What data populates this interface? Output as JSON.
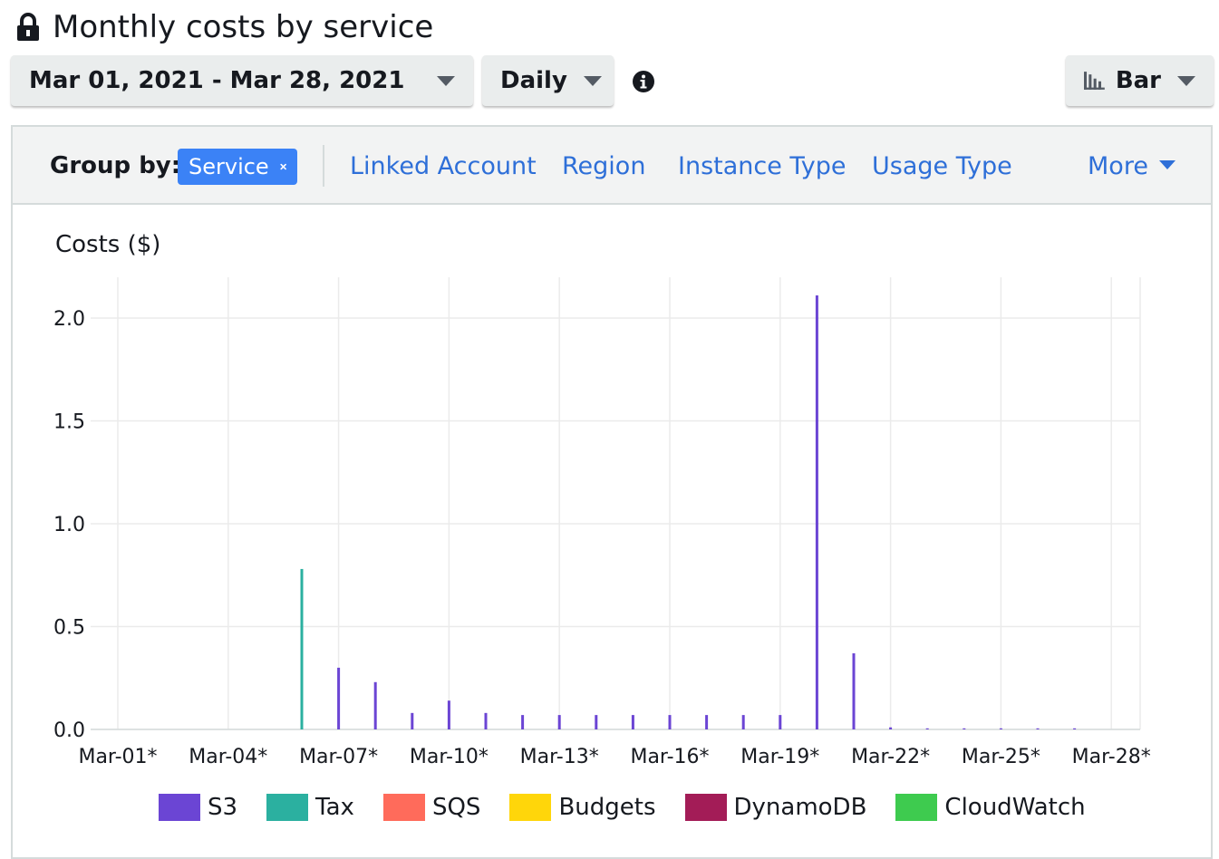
{
  "header": {
    "title": "Monthly costs by service"
  },
  "controls": {
    "date_range": "Mar 01, 2021 - Mar 28, 2021",
    "granularity": "Daily",
    "chart_type": "Bar"
  },
  "group_by": {
    "label": "Group by:",
    "active_chip": "Service",
    "options": [
      "Linked Account",
      "Region",
      "Instance Type",
      "Usage Type"
    ],
    "more": "More"
  },
  "chart_data": {
    "type": "bar",
    "ylabel": "Costs ($)",
    "ylim": [
      0,
      2.2
    ],
    "yticks": [
      "0.0",
      "0.5",
      "1.0",
      "1.5",
      "2.0"
    ],
    "xtick_labels": [
      "Mar-01*",
      "Mar-04*",
      "Mar-07*",
      "Mar-10*",
      "Mar-13*",
      "Mar-16*",
      "Mar-19*",
      "Mar-22*",
      "Mar-25*",
      "Mar-28*"
    ],
    "categories": [
      "Mar-01",
      "Mar-02",
      "Mar-03",
      "Mar-04",
      "Mar-05",
      "Mar-06",
      "Mar-07",
      "Mar-08",
      "Mar-09",
      "Mar-10",
      "Mar-11",
      "Mar-12",
      "Mar-13",
      "Mar-14",
      "Mar-15",
      "Mar-16",
      "Mar-17",
      "Mar-18",
      "Mar-19",
      "Mar-20",
      "Mar-21",
      "Mar-22",
      "Mar-23",
      "Mar-24",
      "Mar-25",
      "Mar-26",
      "Mar-27",
      "Mar-28"
    ],
    "series": [
      {
        "name": "S3",
        "color": "#6b45d4",
        "values": [
          0,
          0,
          0,
          0,
          0,
          0,
          0.3,
          0.23,
          0.08,
          0.14,
          0.08,
          0.07,
          0.07,
          0.07,
          0.07,
          0.07,
          0.07,
          0.07,
          0.07,
          2.11,
          0.37,
          0.01,
          0.005,
          0.005,
          0.005,
          0.005,
          0.005,
          0
        ]
      },
      {
        "name": "Tax",
        "color": "#2bb0a0",
        "values": [
          0,
          0,
          0,
          0,
          0,
          0.78,
          0,
          0,
          0,
          0,
          0,
          0,
          0,
          0,
          0,
          0,
          0,
          0,
          0,
          0,
          0,
          0,
          0,
          0,
          0,
          0,
          0,
          0
        ]
      },
      {
        "name": "SQS",
        "color": "#ff6b5b",
        "values": [
          0,
          0,
          0,
          0,
          0,
          0,
          0,
          0,
          0,
          0,
          0,
          0,
          0,
          0,
          0,
          0,
          0,
          0,
          0,
          0,
          0,
          0,
          0,
          0,
          0,
          0,
          0,
          0
        ]
      },
      {
        "name": "Budgets",
        "color": "#ffd60a",
        "values": [
          0,
          0,
          0,
          0,
          0,
          0,
          0,
          0,
          0,
          0,
          0,
          0,
          0,
          0,
          0,
          0,
          0,
          0,
          0,
          0,
          0,
          0,
          0,
          0,
          0,
          0,
          0,
          0
        ]
      },
      {
        "name": "DynamoDB",
        "color": "#a31c57",
        "values": [
          0,
          0,
          0,
          0,
          0,
          0,
          0,
          0,
          0,
          0,
          0,
          0,
          0,
          0,
          0,
          0,
          0,
          0,
          0,
          0,
          0,
          0,
          0,
          0,
          0,
          0,
          0,
          0
        ]
      },
      {
        "name": "CloudWatch",
        "color": "#3ecb4f",
        "values": [
          0,
          0,
          0,
          0,
          0,
          0,
          0,
          0,
          0,
          0,
          0,
          0,
          0,
          0,
          0,
          0,
          0,
          0,
          0,
          0,
          0,
          0,
          0,
          0,
          0,
          0,
          0,
          0
        ]
      }
    ],
    "grid": true,
    "legend_position": "bottom"
  }
}
